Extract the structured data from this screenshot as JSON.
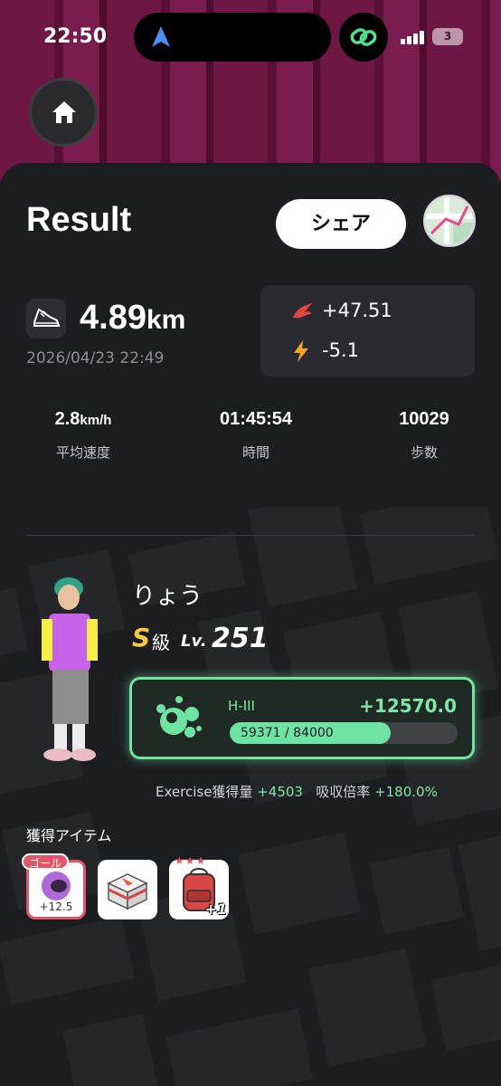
{
  "status_bar": {
    "time": "22:50",
    "battery": "3"
  },
  "header": {
    "title": "Result",
    "share_label": "シェア"
  },
  "run": {
    "distance_value": "4.89",
    "distance_unit": "km",
    "datetime": "2026/04/23 22:49",
    "stat_fire": "+47.51",
    "stat_energy": "-5.1"
  },
  "metrics": [
    {
      "value": "2.8",
      "unit": "km/h",
      "label": "平均速度"
    },
    {
      "value": "01:45:54",
      "unit": "",
      "label": "時間"
    },
    {
      "value": "10029",
      "unit": "",
      "label": "歩数"
    }
  ],
  "character": {
    "name": "りょう",
    "rank_letter": "S",
    "rank_suffix": "級",
    "level_label": "Lv.",
    "level": "251"
  },
  "exp": {
    "grade": "H-III",
    "gain": "+12570.0",
    "progress_text": "59371 / 84000",
    "current": 59371,
    "max": 84000,
    "accent": "#6fe3a2"
  },
  "absorb": {
    "exercise_label": "Exercise獲得量",
    "exercise_value": "+4503",
    "rate_label": "吸収倍率",
    "rate_value": "+180.0%"
  },
  "items": {
    "title": "獲得アイテム",
    "goal_tag": "ゴール",
    "goal_amount": "+12.5",
    "bag_bonus": "+1"
  },
  "icons": {
    "home": "home-icon",
    "shoe": "shoe-icon",
    "fire": "fire-icon",
    "lightning": "lightning-icon"
  }
}
